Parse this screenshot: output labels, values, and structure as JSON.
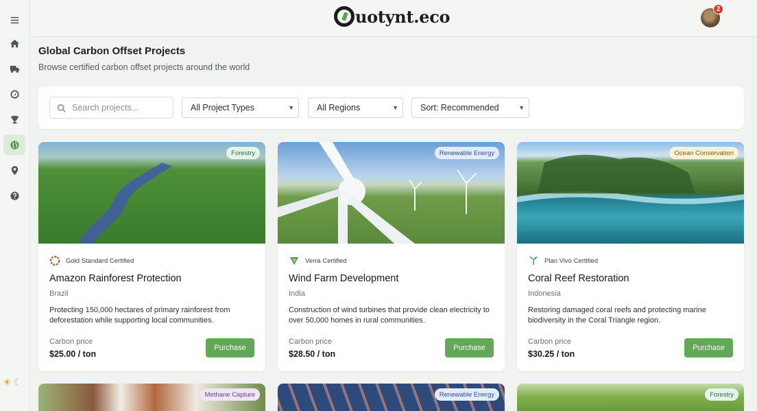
{
  "header": {
    "logo_text": "uotynt.eco",
    "notification_count": "2"
  },
  "page": {
    "title": "Global Carbon Offset Projects",
    "subtitle": "Browse certified carbon offset projects around the world"
  },
  "filters": {
    "search_placeholder": "Search projects...",
    "project_type": "All Project Types",
    "region": "All Regions",
    "sort": "Sort: Recommended"
  },
  "sidebar": {
    "items": [
      {
        "name": "menu",
        "icon": "menu-icon"
      },
      {
        "name": "home",
        "icon": "home-icon"
      },
      {
        "name": "shipping",
        "icon": "truck-icon"
      },
      {
        "name": "dashboard",
        "icon": "gauge-icon"
      },
      {
        "name": "achievements",
        "icon": "trophy-icon"
      },
      {
        "name": "projects",
        "icon": "globe-icon",
        "active": true
      },
      {
        "name": "locations",
        "icon": "map-pin-icon"
      },
      {
        "name": "help",
        "icon": "help-icon"
      }
    ],
    "theme_icons": [
      "sun-icon",
      "moon-icon"
    ]
  },
  "cards": [
    {
      "tag": "Forestry",
      "certification": "Gold Standard Certified",
      "title": "Amazon Rainforest Protection",
      "location": "Brazil",
      "description": "Protecting 150,000 hectares of primary rainforest from deforestation while supporting local communities.",
      "price_label": "Carbon price",
      "price": "$25.00 / ton",
      "button": "Purchase"
    },
    {
      "tag": "Renewable Energy",
      "certification": "Verra Certified",
      "title": "Wind Farm Development",
      "location": "India",
      "description": "Construction of wind turbines that provide clean electricity to over 50,000 homes in rural communities.",
      "price_label": "Carbon price",
      "price": "$28.50 / ton",
      "button": "Purchase"
    },
    {
      "tag": "Ocean Conservation",
      "certification": "Plan Vivo Certified",
      "title": "Coral Reef Restoration",
      "location": "Indonesia",
      "description": "Restoring damaged coral reefs and protecting marine biodiversity in the Coral Triangle region.",
      "price_label": "Carbon price",
      "price": "$30.25 / ton",
      "button": "Purchase"
    }
  ],
  "partial_cards": [
    {
      "tag": "Methane Capture"
    },
    {
      "tag": "Renewable Energy"
    },
    {
      "tag": "Forestry"
    }
  ],
  "colors": {
    "accent": "#63a858",
    "background": "#f1f3f0",
    "badge": "#e5342d"
  }
}
